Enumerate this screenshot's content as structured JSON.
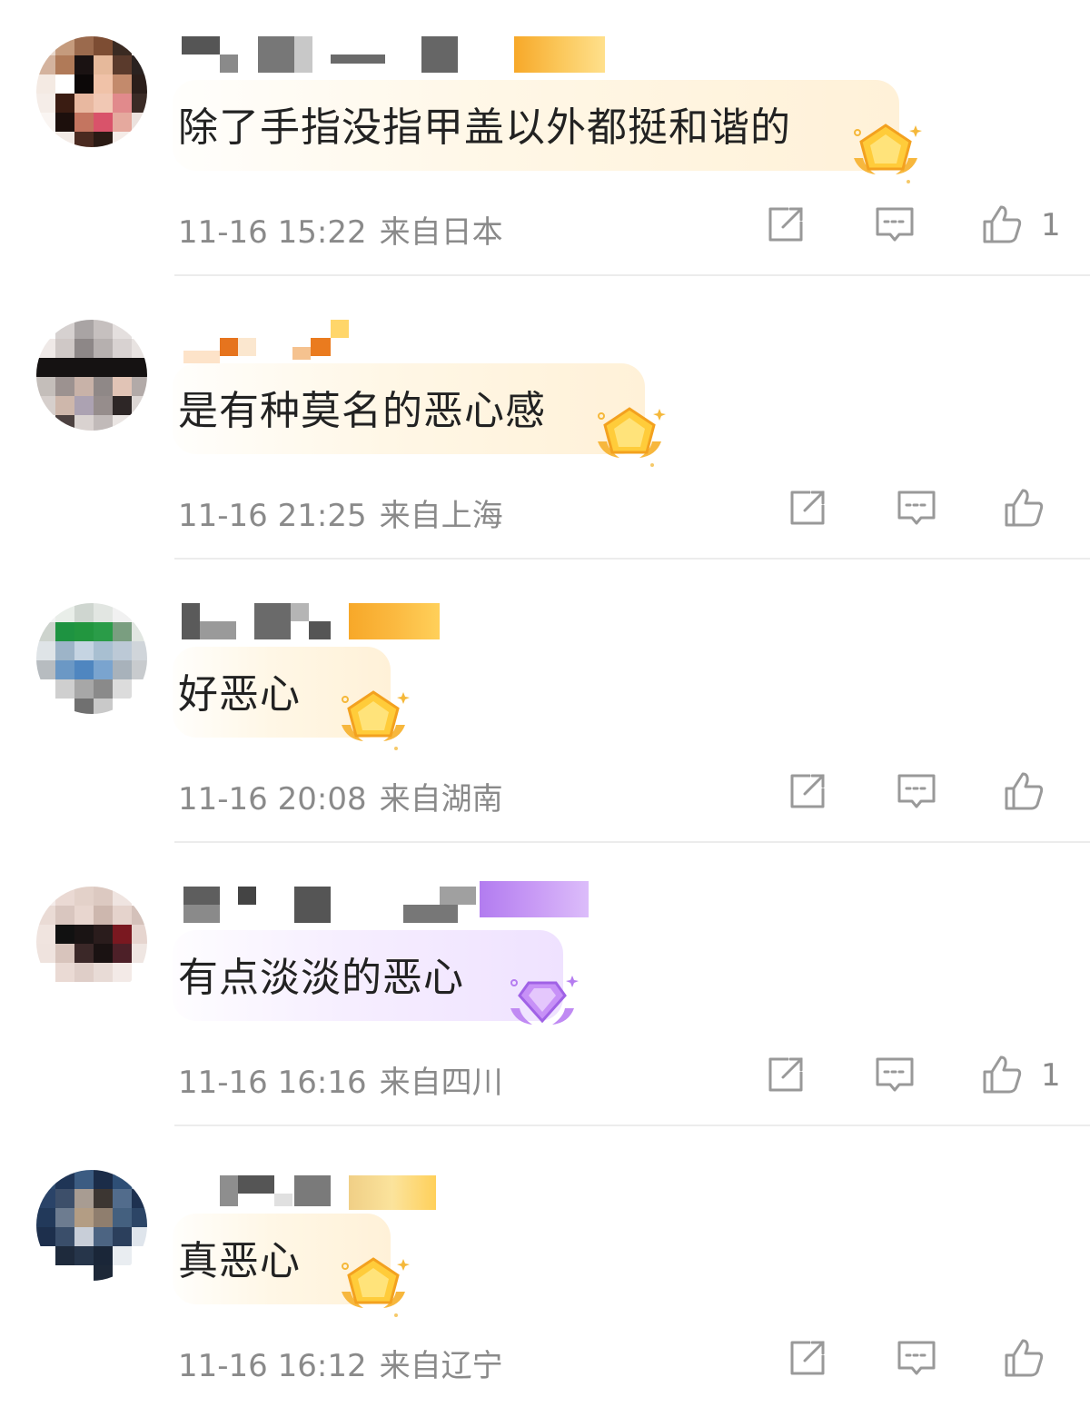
{
  "comments": [
    {
      "text": "除了手指没指甲盖以外都挺和谐的",
      "time": "11-16 15:22",
      "location": "来自日本",
      "likes": "1",
      "badge": "gold"
    },
    {
      "text": "是有种莫名的恶心感",
      "time": "11-16 21:25",
      "location": "来自上海",
      "likes": "",
      "badge": "gold"
    },
    {
      "text": "好恶心",
      "time": "11-16 20:08",
      "location": "来自湖南",
      "likes": "",
      "badge": "gold"
    },
    {
      "text": "有点淡淡的恶心",
      "time": "11-16 16:16",
      "location": "来自四川",
      "likes": "1",
      "badge": "purple"
    },
    {
      "text": "真恶心",
      "time": "11-16 16:12",
      "location": "来自辽宁",
      "likes": "",
      "badge": "gold"
    }
  ],
  "icons": {
    "share": "share-icon",
    "comment": "comment-icon",
    "like": "thumbs-up-icon",
    "avatar": "pixelated-avatar-icon",
    "medal": "fan-medal-icon"
  },
  "colors": {
    "text": "#222222",
    "meta": "#8a8a8a",
    "gold_badge": "#f7a829",
    "purple_badge": "#b37cf2",
    "divider": "#ececec"
  }
}
